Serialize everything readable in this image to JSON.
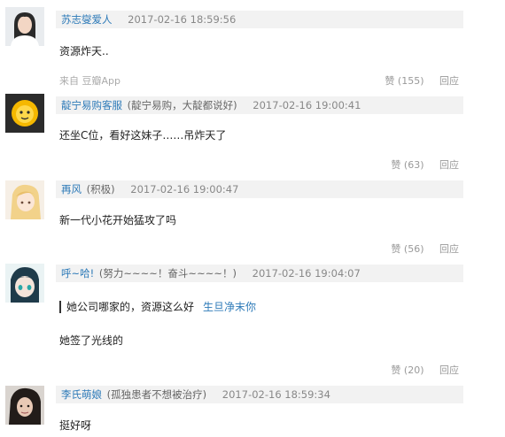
{
  "comments": [
    {
      "username": "苏志燮爱人",
      "tag": "",
      "date": "2017-02-16 18:59:56",
      "text": "资源炸天..",
      "source": "来自 豆瓣App",
      "likes": "赞 (155)",
      "reply": "回应",
      "avatar_icon": "avatar-girl-white-shirt"
    },
    {
      "username": "靛宁易购客服",
      "tag": "(靛宁易购，大靛都说好)",
      "date": "2017-02-16 19:00:41",
      "text": "还坐C位，看好这妹子……吊炸天了",
      "likes": "赞 (63)",
      "reply": "回应",
      "avatar_icon": "avatar-lion-logo"
    },
    {
      "username": "再风",
      "tag": "(积极)",
      "date": "2017-02-16 19:00:47",
      "text": "新一代小花开始猛攻了吗",
      "likes": "赞 (56)",
      "reply": "回应",
      "avatar_icon": "avatar-anime-blonde"
    },
    {
      "username": "呼~哈!",
      "tag": "(努力~~~~！奋斗~~~~！)",
      "date": "2017-02-16 19:04:07",
      "quote_text": "她公司哪家的，资源这么好",
      "quote_author": "生旦净末你",
      "text": "她签了光线的",
      "likes": "赞 (20)",
      "reply": "回应",
      "avatar_icon": "avatar-anime-blue"
    },
    {
      "username": "李氏萌娘",
      "tag": "(孤独患者不想被治疗)",
      "date": "2017-02-16 18:59:34",
      "text": "挺好呀",
      "avatar_icon": "avatar-girl-dark-hair"
    }
  ],
  "colors": {
    "username": "#2d7ab8",
    "header_bg": "#f2f2f2",
    "meta": "#999999",
    "lion_bg": "#2b2b2b",
    "lion_face": "#f5b800"
  }
}
